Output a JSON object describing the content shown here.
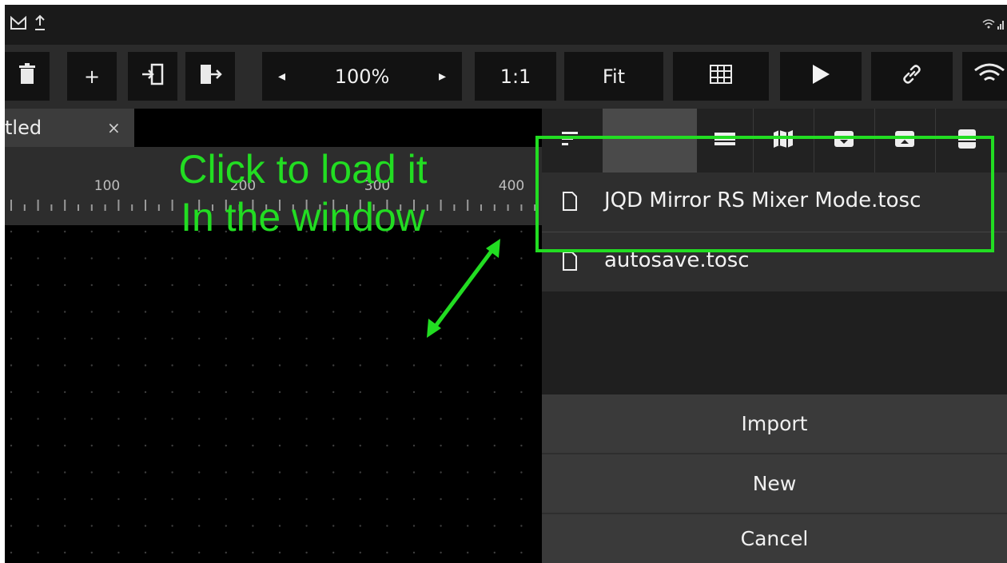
{
  "status_bar": {
    "left_icons": [
      "gmail-icon",
      "upload-icon"
    ],
    "right_icons": [
      "wifi-signal-icon"
    ]
  },
  "toolbar": {
    "zoom_value": "100%",
    "zoom_left": "◂",
    "zoom_right": "▸",
    "one_to_one_label": "1:1",
    "fit_label": "Fit",
    "add_label": "+"
  },
  "tab": {
    "label": "tled",
    "close": "×"
  },
  "ruler": {
    "labels": [
      "100",
      "200",
      "300",
      "400"
    ]
  },
  "annotation": {
    "line1": "Click to load it",
    "line2": "In the window",
    "color": "#22dd22"
  },
  "file_panel": {
    "files": [
      "JQD Mirror RS Mixer Mode.tosc",
      "autosave.tosc"
    ],
    "buttons": {
      "import": "Import",
      "new": "New",
      "cancel": "Cancel"
    }
  },
  "colors": {
    "background": "#000000",
    "toolbar": "#2b2b2b",
    "panel": "#2e2e2e",
    "button_row": "#3a3a3a",
    "highlight": "#22dd22"
  }
}
